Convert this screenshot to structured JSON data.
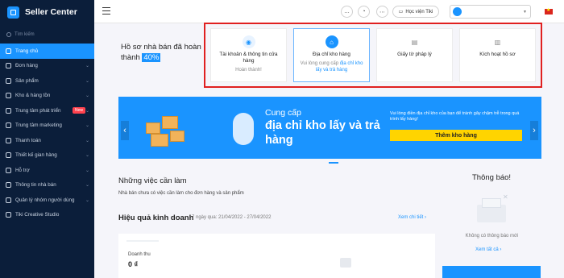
{
  "app": {
    "title": "Seller Center"
  },
  "sidebar": {
    "search_placeholder": "Tìm kiếm",
    "items": [
      {
        "label": "Trang chủ",
        "active": true,
        "chevron": false
      },
      {
        "label": "Đơn hàng",
        "chevron": true
      },
      {
        "label": "Sản phẩm",
        "chevron": true
      },
      {
        "label": "Kho & hàng tồn",
        "chevron": true
      },
      {
        "label": "Trung tâm phát triển",
        "badge": "New",
        "chevron": true
      },
      {
        "label": "Trung tâm marketing",
        "chevron": true
      },
      {
        "label": "Thanh toán",
        "chevron": true
      },
      {
        "label": "Thiết kế gian hàng",
        "chevron": true
      },
      {
        "label": "Hỗ trợ",
        "chevron": true
      },
      {
        "label": "Thông tin nhà bán",
        "chevron": true
      },
      {
        "label": "Quản lý nhóm người dùng",
        "chevron": true
      },
      {
        "label": "Tiki Creative Studio",
        "chevron": false
      }
    ]
  },
  "topbar": {
    "library_label": "Học viện Tiki"
  },
  "profile": {
    "title": "Hồ sơ nhà bán đã hoàn thành",
    "percent": "40%",
    "steps": [
      {
        "title": "Tài khoản & thông tin cửa hàng",
        "sub": "Hoàn thành!",
        "icon": "user-check-icon"
      },
      {
        "title": "Địa chỉ kho hàng",
        "sub_prefix": "Vui lòng cung cấp ",
        "sub_link": "địa chỉ kho lấy và trả hàng",
        "icon": "warehouse-icon"
      },
      {
        "title": "Giấy tờ pháp lý",
        "icon": "document-icon"
      },
      {
        "title": "Kích hoạt hồ sơ",
        "icon": "clipboard-icon"
      }
    ]
  },
  "banner": {
    "lead": "Cung cấp",
    "headline": "địa chỉ kho lấy và trả hàng",
    "note": "Vui lòng điền địa chỉ kho của bạn để tránh gây chậm trễ trong quá trình lấy hàng!",
    "button": "Thêm kho hàng"
  },
  "todo": {
    "title": "Những việc cần làm",
    "subtitle": "Nhà bán chưa có việc cần làm cho đơn hàng và sản phẩm"
  },
  "performance": {
    "title": "Hiệu quả kinh doanh",
    "date_range": "7 ngày qua: 21/04/2022 - 27/04/2022",
    "more": "Xem chi tiết",
    "revenue_label": "Doanh thu",
    "revenue_value": "0 ₫"
  },
  "notifications": {
    "title": "Thông báo!",
    "empty": "Không có thông báo mới",
    "view_all": "Xem tất cả"
  },
  "colors": {
    "sidebar_bg": "#0b1e3a",
    "accent": "#1a94ff",
    "highlight_border": "#e02020",
    "cta": "#ffd400"
  }
}
